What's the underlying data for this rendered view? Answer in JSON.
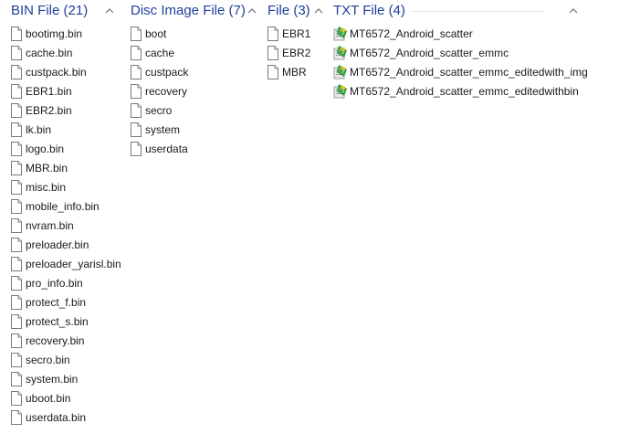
{
  "groups": [
    {
      "title": "BIN File (21)",
      "items": [
        "bootimg.bin",
        "cache.bin",
        "custpack.bin",
        "EBR1.bin",
        "EBR2.bin",
        "lk.bin",
        "logo.bin",
        "MBR.bin",
        "misc.bin",
        "mobile_info.bin",
        "nvram.bin",
        "preloader.bin",
        "preloader_yarisl.bin",
        "pro_info.bin",
        "protect_f.bin",
        "protect_s.bin",
        "recovery.bin",
        "secro.bin",
        "system.bin",
        "uboot.bin",
        "userdata.bin"
      ]
    },
    {
      "title": "Disc Image File (7)",
      "items": [
        "boot",
        "cache",
        "custpack",
        "recovery",
        "secro",
        "system",
        "userdata"
      ]
    },
    {
      "title": "File (3)",
      "items": [
        "EBR1",
        "EBR2",
        "MBR"
      ]
    },
    {
      "title": "TXT File (4)",
      "items": [
        "MT6572_Android_scatter",
        "MT6572_Android_scatter_emmc",
        "MT6572_Android_scatter_emmc_editedwith_img",
        "MT6572_Android_scatter_emmc_editedwithbin"
      ]
    }
  ],
  "icons": {
    "generic_file": "blank-file-icon",
    "txt_file": "scatter-txt-file-icon"
  },
  "colors": {
    "group_title": "#1f3f99",
    "chevron": "#6a7280",
    "divider": "#e3e6ea",
    "item_text": "#1a1a1a"
  }
}
